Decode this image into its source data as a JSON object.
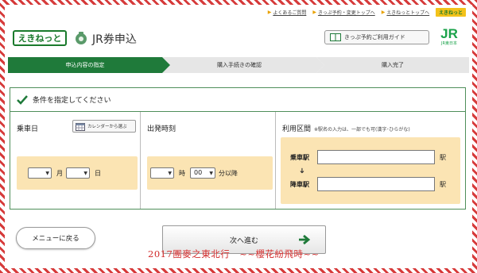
{
  "top_links": [
    {
      "label": "よくあるご質問"
    },
    {
      "label": "きっぷ予約・変更トップへ"
    },
    {
      "label": "えきねっとトップへ"
    }
  ],
  "top_badge": "えきねっと",
  "header": {
    "logo_text": "えきねっと",
    "title": "JR券申込",
    "guide_label": "きっぷ予約ご利用ガイド",
    "jr_mark": "JR",
    "jr_sub": "JR東日本"
  },
  "steps": [
    {
      "label": "申込内容の指定"
    },
    {
      "label": "購入手続きの確認"
    },
    {
      "label": "購入完了"
    }
  ],
  "panel": {
    "heading": "条件を指定してください",
    "boarding_date": {
      "label": "乗車日",
      "calendar_label": "カレンダーから選ぶ",
      "month_value": "",
      "month_unit": "月",
      "day_value": "",
      "day_unit": "日"
    },
    "departure_time": {
      "label": "出発時刻",
      "hour_value": "",
      "hour_unit": "時",
      "minute_value": "00",
      "minute_unit": "分以降"
    },
    "route": {
      "label": "利用区間",
      "note": "※駅名の入力は、一部でも可(漢字･ひらがな)",
      "board_label": "乗車駅",
      "alight_label": "降車駅",
      "station_unit": "駅",
      "board_value": "",
      "alight_value": ""
    }
  },
  "buttons": {
    "menu_label": "メニューに戻る",
    "next_label": "次へ進む"
  },
  "watermark": "2017團麥之東北行　~~櫻花紛飛時~~",
  "colors": {
    "brand_green": "#1f7a3a",
    "field_bg": "#fbe4b3",
    "frame_red": "#d63a3a",
    "watermark": "#d12a2a"
  }
}
